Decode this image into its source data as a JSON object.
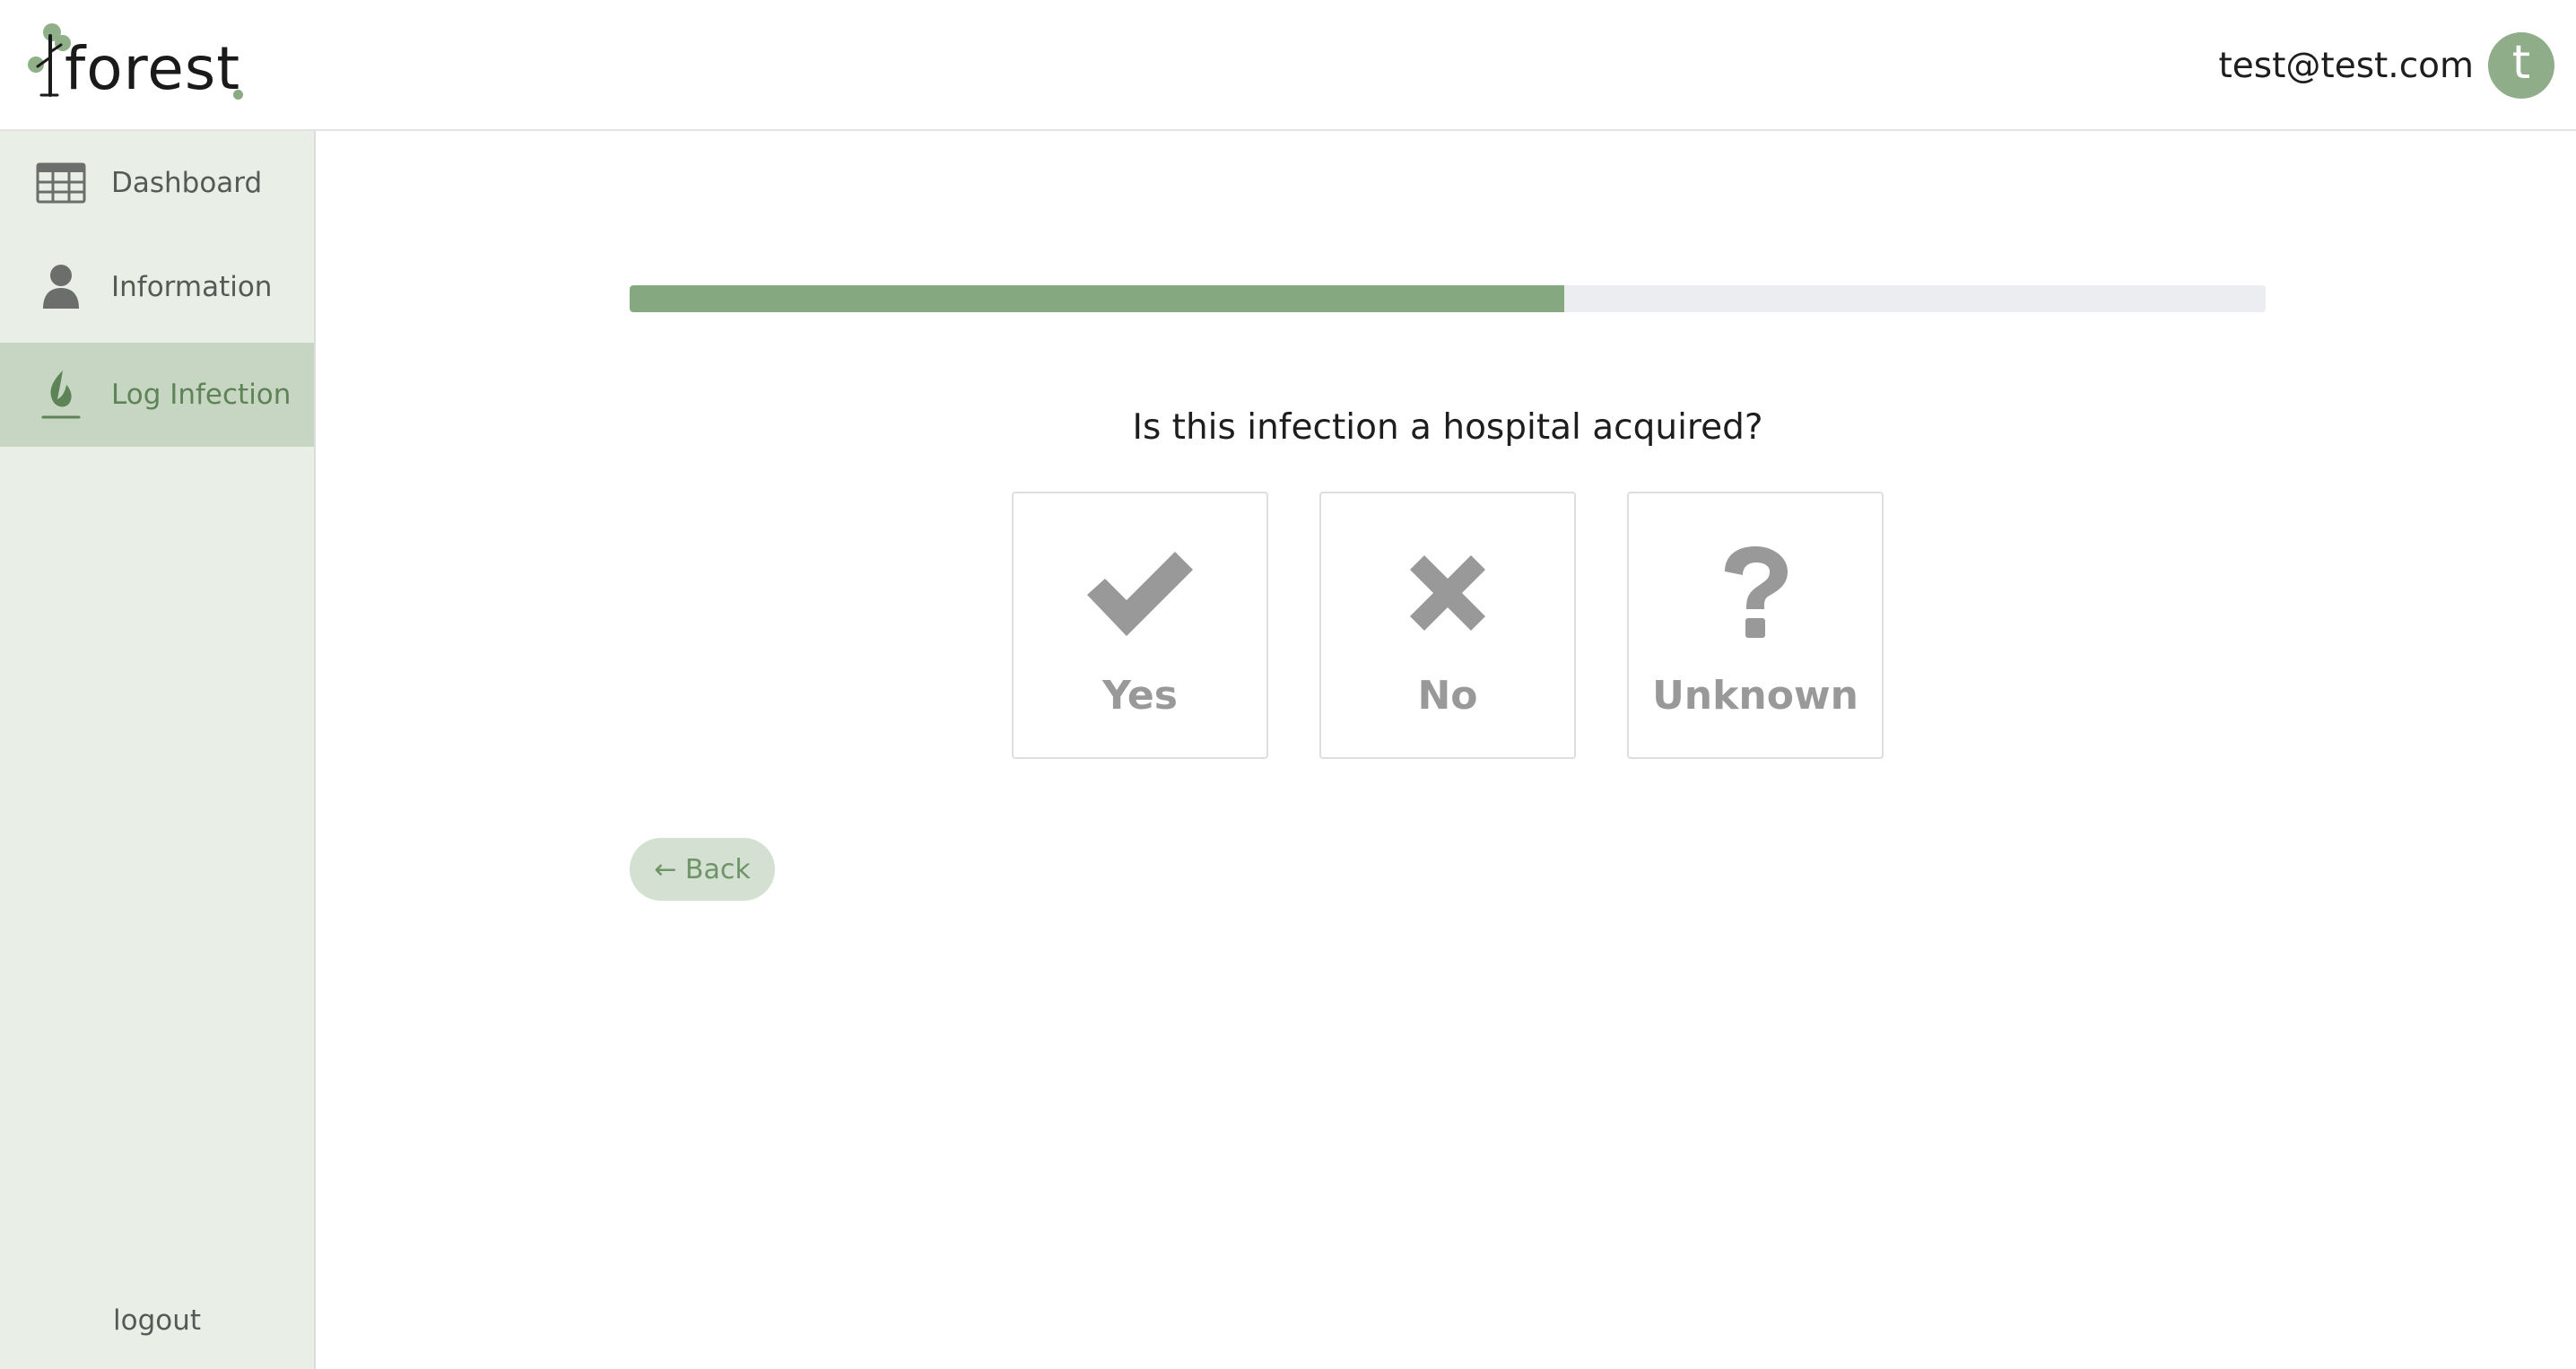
{
  "header": {
    "logo_text": "forest",
    "user_email": "test@test.com",
    "avatar_initial": "t"
  },
  "sidebar": {
    "items": [
      {
        "label": "Dashboard",
        "icon": "table-grid-icon",
        "active": false
      },
      {
        "label": "Information",
        "icon": "person-icon",
        "active": false
      },
      {
        "label": "Log Infection",
        "icon": "leaf-icon",
        "active": true
      }
    ],
    "logout_label": "logout"
  },
  "main": {
    "progress": 0.571,
    "question": "Is this infection a hospital acquired?",
    "options": [
      {
        "label": "Yes",
        "icon": "checkmark-icon"
      },
      {
        "label": "No",
        "icon": "x-mark-icon"
      },
      {
        "label": "Unknown",
        "icon": "question-mark-icon"
      }
    ],
    "back_label": "← Back"
  },
  "colors": {
    "accent": "#86a880",
    "sidebar_bg": "#e9eee7",
    "active_nav_bg": "#c7d6c3",
    "option_icon": "#999999"
  }
}
